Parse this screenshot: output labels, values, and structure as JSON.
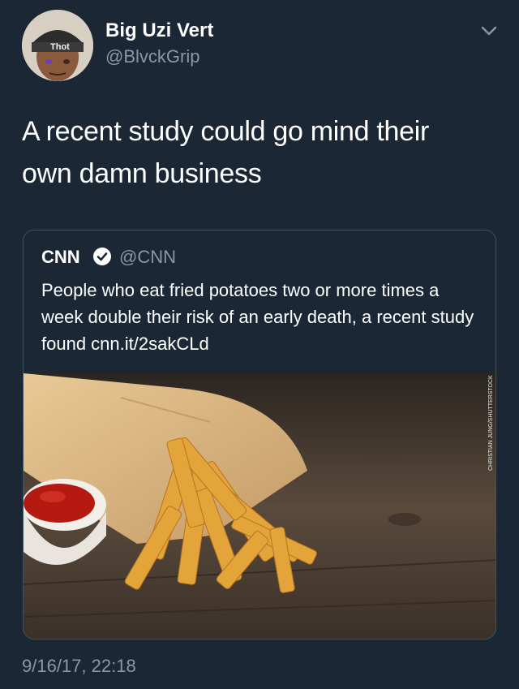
{
  "author": {
    "name": "Big Uzi Vert",
    "handle": "@BlvckGrip",
    "avatar_label": "Thot"
  },
  "tweet": {
    "text": "A recent study could go mind their own damn business",
    "timestamp": "9/16/17, 22:18"
  },
  "quoted_tweet": {
    "name": "CNN",
    "handle": "@CNN",
    "verified": true,
    "text": "People who eat fried potatoes two or more times a week double their risk of an early death, a recent study found cnn.it/2sakCLd",
    "image_credit": "CHRISTIAN JUNG/SHUTTERSTOCK"
  },
  "icons": {
    "menu": "chevron-down-icon",
    "verified": "verified-badge-icon"
  },
  "colors": {
    "background": "#1b2735",
    "secondary_text": "#8899a6",
    "card_border": "#3d5466"
  }
}
